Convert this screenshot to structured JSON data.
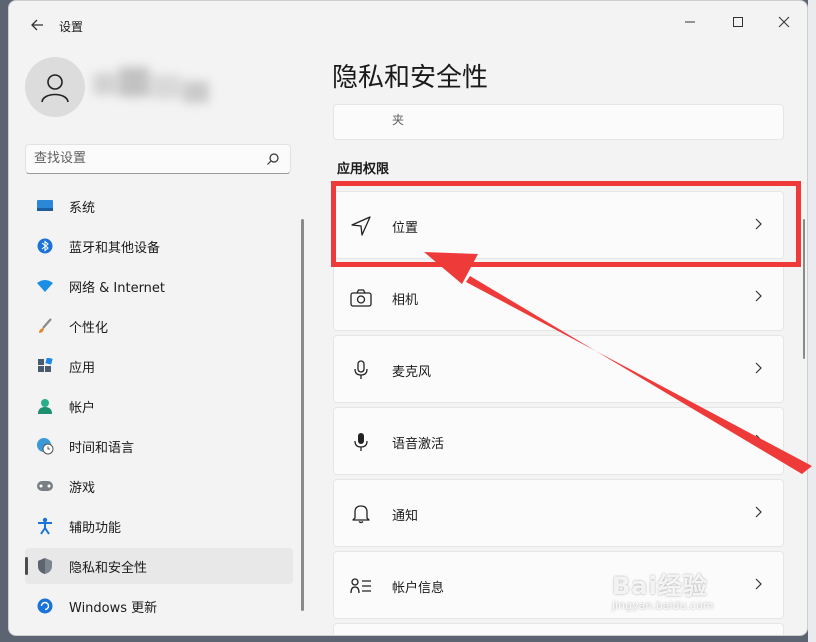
{
  "app": {
    "title": "设置"
  },
  "profile": {
    "name_hidden": true
  },
  "search": {
    "placeholder": "查找设置"
  },
  "sidebar": {
    "items": [
      {
        "label": "系统",
        "icon": "display-icon",
        "selected": false
      },
      {
        "label": "蓝牙和其他设备",
        "icon": "bluetooth-icon",
        "selected": false
      },
      {
        "label": "网络 & Internet",
        "icon": "wifi-icon",
        "selected": false
      },
      {
        "label": "个性化",
        "icon": "brush-icon",
        "selected": false
      },
      {
        "label": "应用",
        "icon": "apps-icon",
        "selected": false
      },
      {
        "label": "帐户",
        "icon": "person-icon",
        "selected": false
      },
      {
        "label": "时间和语言",
        "icon": "globe-clock-icon",
        "selected": false
      },
      {
        "label": "游戏",
        "icon": "gamepad-icon",
        "selected": false
      },
      {
        "label": "辅助功能",
        "icon": "accessibility-icon",
        "selected": false
      },
      {
        "label": "隐私和安全性",
        "icon": "shield-icon",
        "selected": true
      },
      {
        "label": "Windows 更新",
        "icon": "update-icon",
        "selected": false
      }
    ]
  },
  "main": {
    "title": "隐私和安全性",
    "prev_card_text": "夹",
    "section_label": "应用权限",
    "cards": [
      {
        "label": "位置",
        "icon": "location-arrow-icon"
      },
      {
        "label": "相机",
        "icon": "camera-icon"
      },
      {
        "label": "麦克风",
        "icon": "microphone-icon"
      },
      {
        "label": "语音激活",
        "icon": "voice-activation-icon"
      },
      {
        "label": "通知",
        "icon": "bell-icon"
      },
      {
        "label": "帐户信息",
        "icon": "account-info-icon"
      }
    ]
  },
  "annotation": {
    "highlight_color": "#ef3a3a"
  },
  "watermark": {
    "brand": "Bai经验",
    "sub": "jingyan.baidu.com"
  }
}
